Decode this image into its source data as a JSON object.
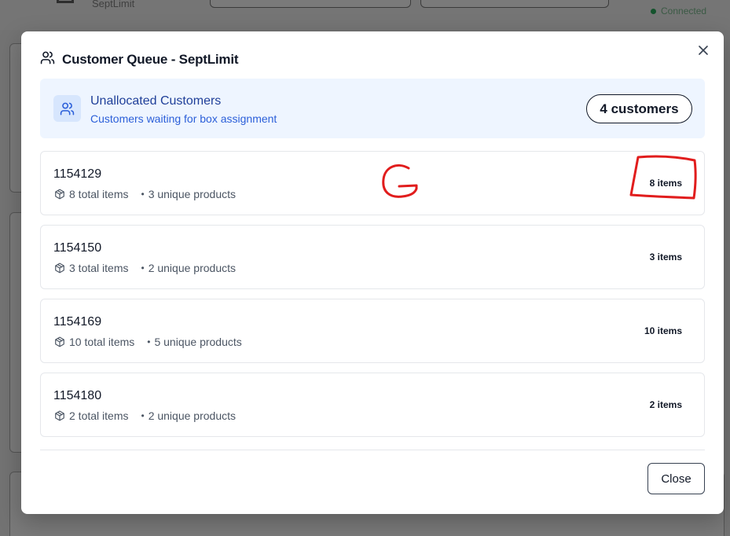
{
  "background": {
    "app_name": "SeptLimit",
    "status": "Connected"
  },
  "modal": {
    "title": "Customer Queue - SeptLimit",
    "close_icon": "x-icon",
    "summary": {
      "icon": "users-icon",
      "title": "Unallocated Customers",
      "subtitle": "Customers waiting for box assignment",
      "count_badge": "4 customers"
    },
    "customers": [
      {
        "id": "1154129",
        "total_items": "8 total items",
        "unique_products": "3 unique products",
        "badge": "8 items"
      },
      {
        "id": "1154150",
        "total_items": "3 total items",
        "unique_products": "2 unique products",
        "badge": "3 items"
      },
      {
        "id": "1154169",
        "total_items": "10 total items",
        "unique_products": "5 unique products",
        "badge": "10 items"
      },
      {
        "id": "1154180",
        "total_items": "2 total items",
        "unique_products": "2 unique products",
        "badge": "2 items"
      }
    ],
    "row_icon": "box-icon",
    "separator": "•",
    "close_button": "Close"
  },
  "annotation": {
    "letter": "G",
    "color": "#e11d1d"
  },
  "colors": {
    "summary_bg": "#eef5ff",
    "summary_title": "#1f3f99",
    "summary_subtitle": "#2b5fd9",
    "status_dot": "#14532d"
  }
}
